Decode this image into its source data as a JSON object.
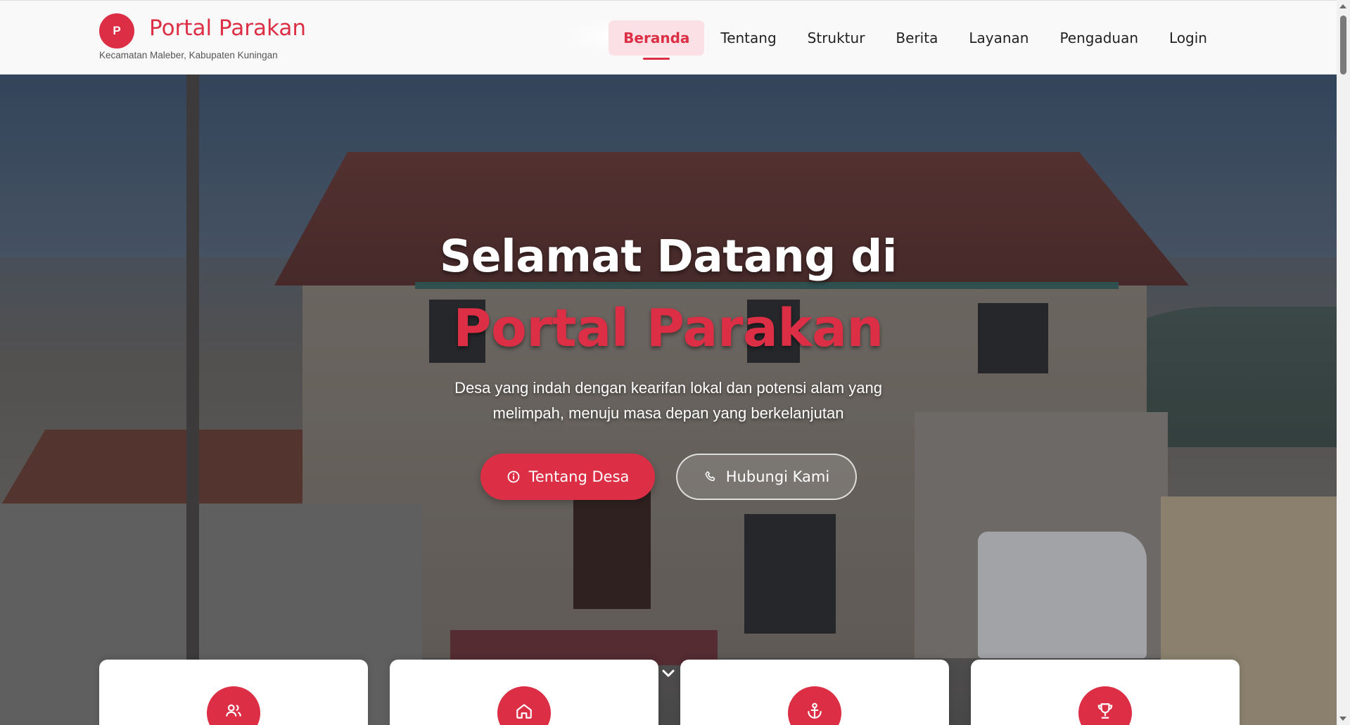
{
  "brand": {
    "logo_letter": "P",
    "name": "Portal Parakan",
    "subtitle": "Kecamatan Maleber, Kabupaten Kuningan",
    "accent_color": "#dc2f45"
  },
  "nav": {
    "items": [
      {
        "label": "Beranda",
        "active": true
      },
      {
        "label": "Tentang",
        "active": false
      },
      {
        "label": "Struktur",
        "active": false
      },
      {
        "label": "Berita",
        "active": false
      },
      {
        "label": "Layanan",
        "active": false
      },
      {
        "label": "Pengaduan",
        "active": false
      },
      {
        "label": "Login",
        "active": false
      }
    ]
  },
  "hero": {
    "title_line1": "Selamat Datang di",
    "title_line2": "Portal Parakan",
    "description": "Desa yang indah dengan kearifan lokal dan potensi alam yang melimpah, menuju masa depan yang berkelanjutan",
    "primary_button": {
      "label": "Tentang Desa",
      "icon": "info-circle-icon"
    },
    "secondary_button": {
      "label": "Hubungi Kami",
      "icon": "phone-icon"
    },
    "scroll_icon": "chevron-down-icon"
  },
  "cards": [
    {
      "icon": "users-icon"
    },
    {
      "icon": "home-icon"
    },
    {
      "icon": "anchor-icon"
    },
    {
      "icon": "trophy-icon"
    }
  ]
}
